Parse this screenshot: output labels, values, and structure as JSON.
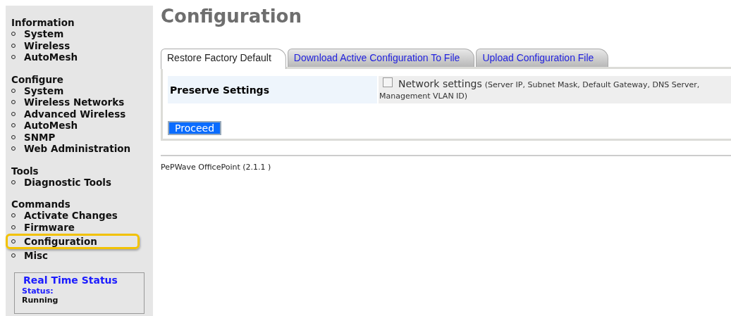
{
  "sidebar": {
    "sections": [
      {
        "heading": "Information",
        "items": [
          {
            "label": "System",
            "selected": false
          },
          {
            "label": "Wireless",
            "selected": false
          },
          {
            "label": "AutoMesh",
            "selected": false
          }
        ]
      },
      {
        "heading": "Configure",
        "items": [
          {
            "label": "System",
            "selected": false
          },
          {
            "label": "Wireless Networks",
            "selected": false
          },
          {
            "label": "Advanced Wireless",
            "selected": false
          },
          {
            "label": "AutoMesh",
            "selected": false
          },
          {
            "label": "SNMP",
            "selected": false
          },
          {
            "label": "Web Administration",
            "selected": false
          }
        ]
      },
      {
        "heading": "Tools",
        "items": [
          {
            "label": "Diagnostic Tools",
            "selected": false
          }
        ]
      },
      {
        "heading": "Commands",
        "items": [
          {
            "label": "Activate Changes",
            "selected": false
          },
          {
            "label": "Firmware",
            "selected": false
          },
          {
            "label": "Configuration",
            "selected": true
          },
          {
            "label": "Misc",
            "selected": false
          }
        ]
      }
    ],
    "status_box": {
      "title": "Real Time Status",
      "label": "Status:",
      "value": "Running"
    }
  },
  "page_title": "Configuration",
  "tabs": [
    {
      "label": "Restore Factory Default",
      "selected": true
    },
    {
      "label": "Download Active Configuration To File",
      "selected": false
    },
    {
      "label": "Upload Configuration File",
      "selected": false
    }
  ],
  "form": {
    "label": "Preserve Settings",
    "option": {
      "label": "Network settings",
      "detail_lines": [
        "(Server IP, Subnet Mask, Default Gateway, DNS Server,",
        "Management VLAN ID)"
      ],
      "checked": false
    },
    "button": "Proceed"
  },
  "footer": "PePWave OfficePoint (2.1.1 )"
}
